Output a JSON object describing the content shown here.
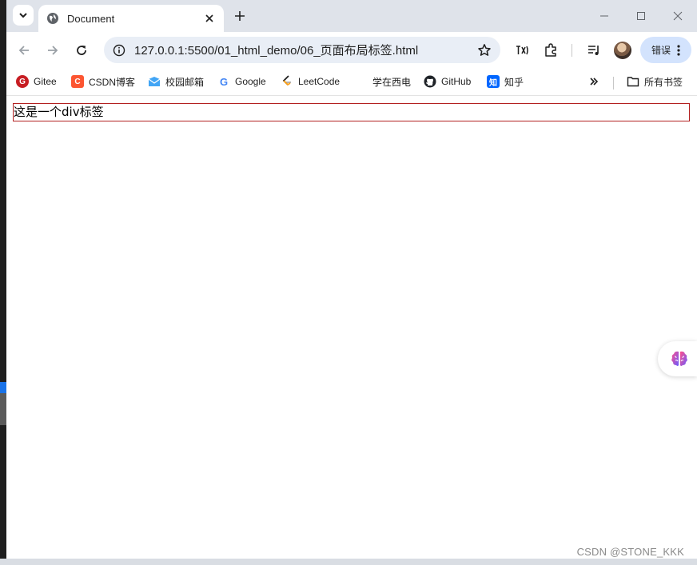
{
  "browser": {
    "tab": {
      "title": "Document"
    },
    "address_bar": {
      "url": "127.0.0.1:5500/01_html_demo/06_页面布局标签.html"
    },
    "profile_button": {
      "label": "错误"
    }
  },
  "bookmarks": [
    {
      "label": "Gitee",
      "icon": "gitee-icon",
      "color": "#c71d23"
    },
    {
      "label": "CSDN博客",
      "icon": "csdn-icon",
      "color": "#fc5531"
    },
    {
      "label": "校园邮箱",
      "icon": "mail-icon",
      "color": "#1e88e5"
    },
    {
      "label": "Google",
      "icon": "google-icon",
      "color": "#4285f4"
    },
    {
      "label": "LeetCode",
      "icon": "leetcode-icon",
      "color": "#ffa116"
    },
    {
      "label": "学在西电",
      "icon": "",
      "color": ""
    },
    {
      "label": "GitHub",
      "icon": "github-icon",
      "color": "#1f2328"
    },
    {
      "label": "知乎",
      "icon": "zhihu-icon",
      "color": "#0066ff"
    }
  ],
  "all_bookmarks_label": "所有书签",
  "page": {
    "div_text": "这是一个div标签",
    "div_border_color": "#b32020"
  },
  "watermark": "CSDN @STONE_KKK"
}
